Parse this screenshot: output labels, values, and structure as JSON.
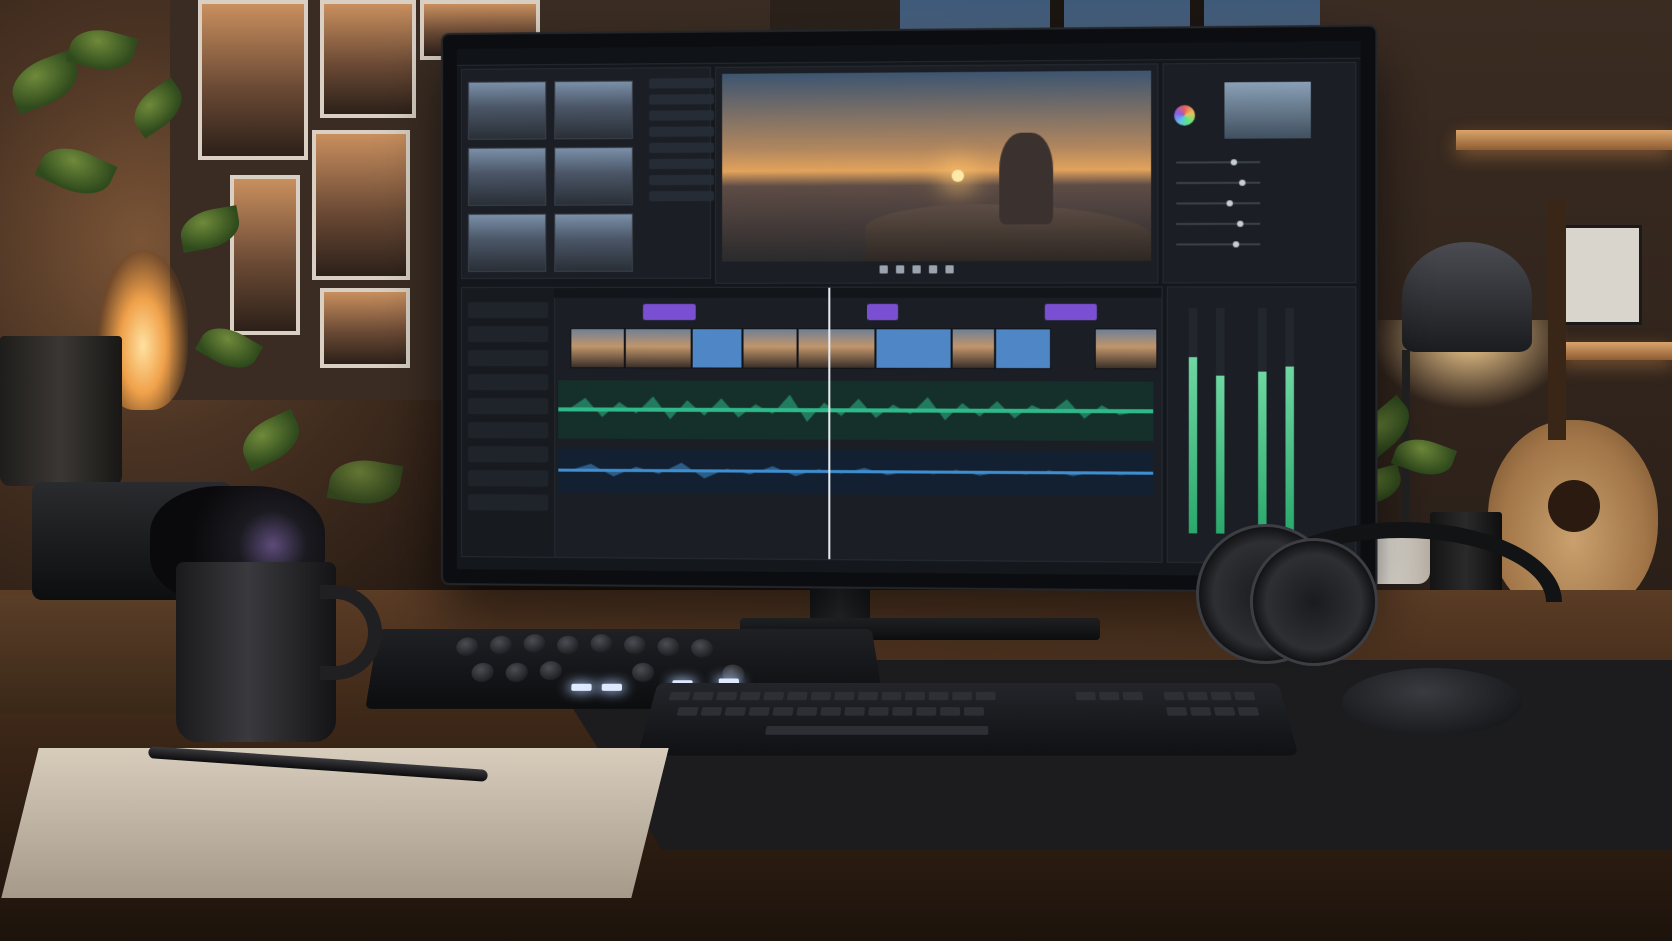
{
  "scene": {
    "colors": {
      "accent_wave_green": "#2fb98b",
      "accent_wave_blue": "#3f8fd0",
      "accent_marker_purple": "#7a4fd1",
      "warm_light": "#f0a14a"
    }
  },
  "editor": {
    "media_thumbnails": 6,
    "timeline_markers": 3,
    "audio_meters": [
      0.78,
      0.7,
      0.72,
      0.74
    ]
  }
}
